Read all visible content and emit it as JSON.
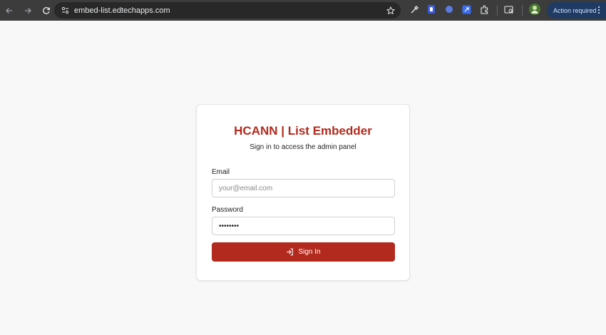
{
  "browser": {
    "url": "embed-list.edtechapps.com",
    "action_required": "Action required"
  },
  "login": {
    "title": "HCANN | List Embedder",
    "subtitle": "Sign in to access the admin panel",
    "email_label": "Email",
    "email_placeholder": "your@email.com",
    "password_label": "Password",
    "password_value": "password",
    "sign_in_label": "Sign In"
  },
  "colors": {
    "brand": "#b22a1d",
    "page_background": "#f8f8f8",
    "toolbar": "#3c3c3c"
  }
}
